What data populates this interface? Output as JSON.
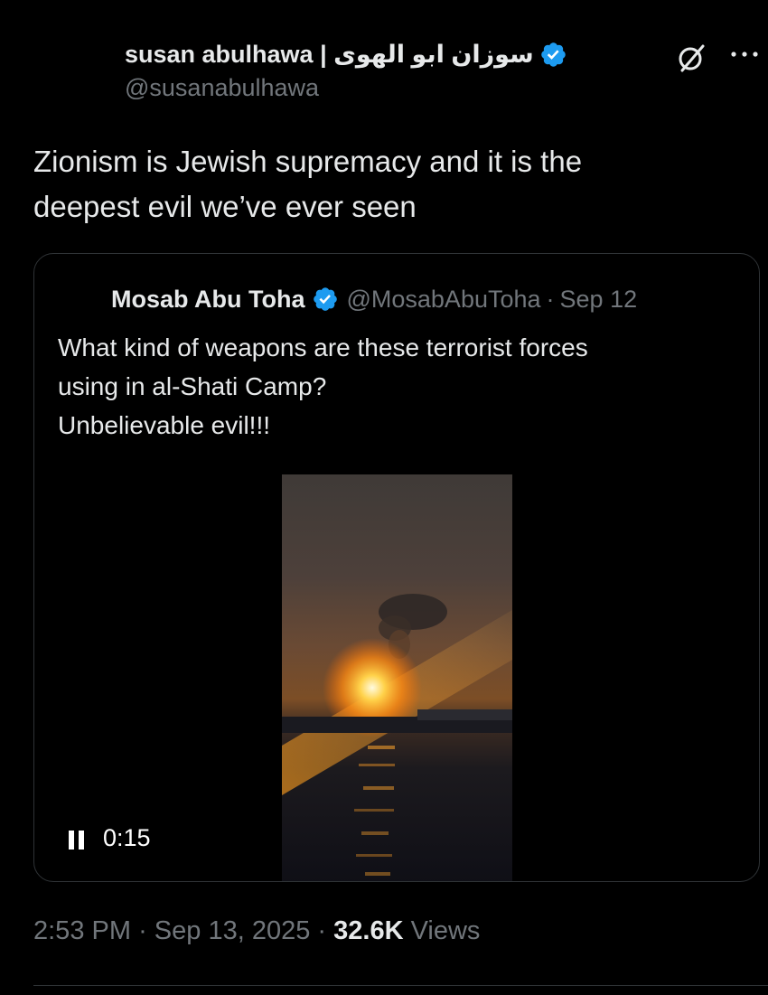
{
  "author": {
    "display_name": "susan abulhawa | سوزان ابو الهوى",
    "handle": "@susanabulhawa",
    "verified": true
  },
  "actions": {
    "grok_icon": "grok-icon",
    "more_icon": "more-horizontal-icon"
  },
  "tweet": {
    "text_line1": "Zionism is Jewish supremacy and it is the",
    "text_line2": "deepest evil we’ve ever seen"
  },
  "quote": {
    "name": "Mosab Abu Toha",
    "handle": "@MosabAbuToha",
    "separator": "·",
    "date": "Sep 12",
    "text_line1": "What kind of weapons are these terrorist forces",
    "text_line2": "using in al-Shati Camp?",
    "text_line3": "Unbelievable evil!!!",
    "video": {
      "time": "0:15",
      "state": "playing"
    }
  },
  "meta": {
    "time": "2:53 PM",
    "separator": "·",
    "date": "Sep 13, 2025",
    "views_count": "32.6K",
    "views_label": "Views"
  },
  "colors": {
    "background": "#000000",
    "text": "#e7e9ea",
    "secondary": "#71767b",
    "verified": "#1d9bf0",
    "border": "#2f3336"
  }
}
